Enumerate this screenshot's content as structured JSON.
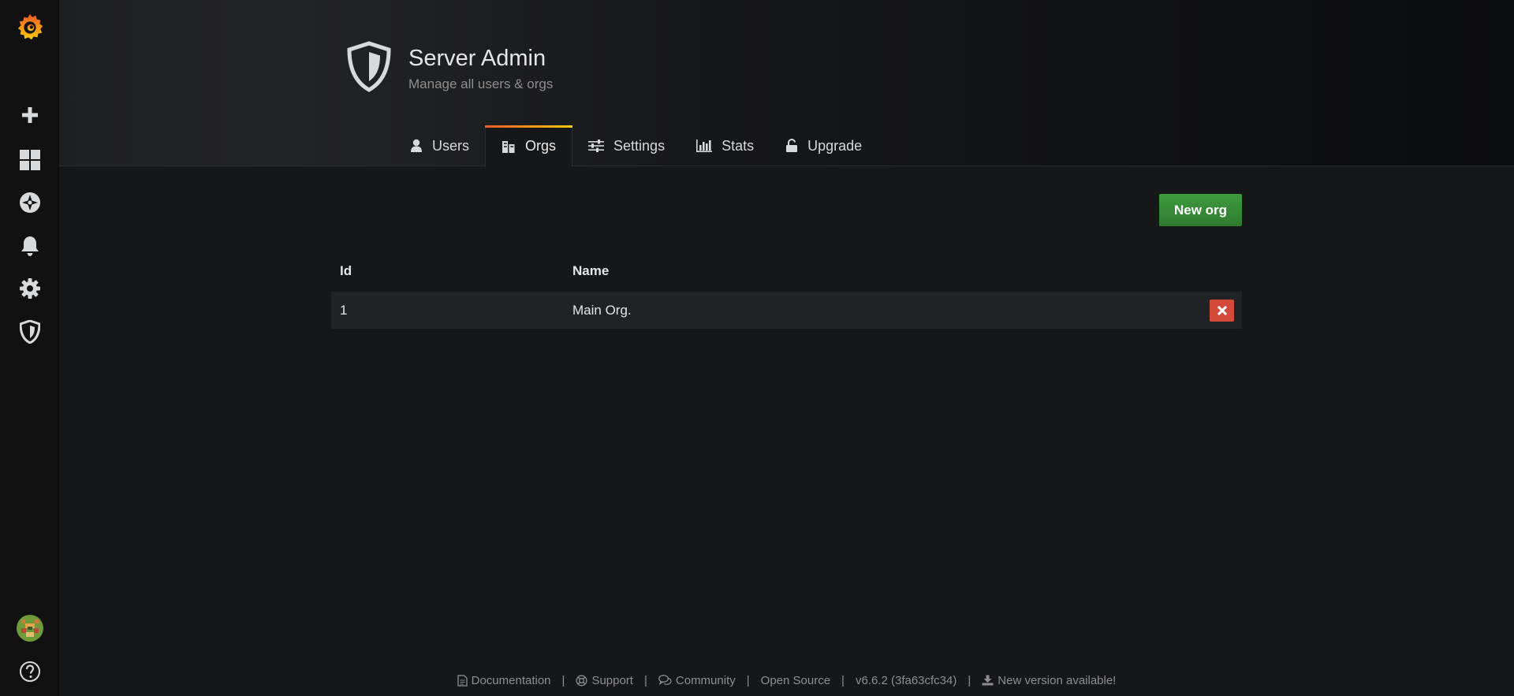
{
  "header": {
    "title": "Server Admin",
    "subtitle": "Manage all users & orgs"
  },
  "tabs": [
    {
      "label": "Users",
      "icon": "user-icon",
      "active": false
    },
    {
      "label": "Orgs",
      "icon": "building-icon",
      "active": true
    },
    {
      "label": "Settings",
      "icon": "sliders-icon",
      "active": false
    },
    {
      "label": "Stats",
      "icon": "bar-chart-icon",
      "active": false
    },
    {
      "label": "Upgrade",
      "icon": "unlock-icon",
      "active": false
    }
  ],
  "actions": {
    "new_org_label": "New org"
  },
  "table": {
    "columns": [
      "Id",
      "Name"
    ],
    "rows": [
      {
        "id": "1",
        "name": "Main Org."
      }
    ]
  },
  "footer": {
    "documentation": "Documentation",
    "support": "Support",
    "community": "Community",
    "open_source": "Open Source",
    "version": "v6.6.2 (3fa63cfc34)",
    "new_version": "New version available!",
    "separator": "|"
  },
  "colors": {
    "background": "#161719",
    "sidebar": "#111111",
    "primary_button": "#3e9b3e",
    "danger_button": "#d44a3a",
    "tab_accent_start": "#f05a28",
    "tab_accent_end": "#fbca0a"
  }
}
